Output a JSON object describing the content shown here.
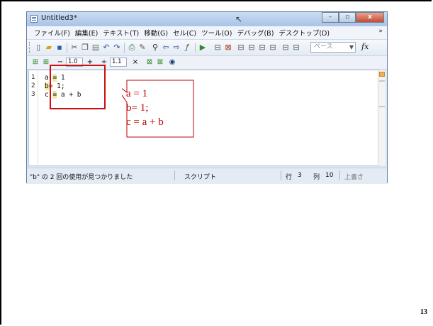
{
  "window": {
    "title": "Untitled3*",
    "minimize": "–",
    "maximize": "▫",
    "close": "x"
  },
  "menu": {
    "items": [
      "ファイル(F)",
      "編集(E)",
      "テキスト(T)",
      "移動(G)",
      "セル(C)",
      "ツール(O)",
      "デバッグ(B)",
      "デスクトップ(D)"
    ],
    "more": "»"
  },
  "toolbar": {
    "base_select": "ベース",
    "fx_label": "fx"
  },
  "cellbar": {
    "minus": "−",
    "value1": "1.0",
    "plus": "+",
    "divide": "÷",
    "value2": "1.1",
    "times": "×"
  },
  "editor": {
    "lines": [
      {
        "no": "1",
        "pre": "a ",
        "hl": "=",
        "post": " 1"
      },
      {
        "no": "2",
        "pre": "",
        "hl": "b",
        "post": "= 1;"
      },
      {
        "no": "3",
        "pre": "c ",
        "hl": "=",
        "post": " a + b"
      }
    ]
  },
  "status": {
    "message": "\"b\" の 2 回の使用が見つかりました",
    "mode": "スクリプト",
    "row_label": "行",
    "row": "3",
    "col_label": "列",
    "col": "10",
    "overwrite": "上書き"
  },
  "callout": {
    "text": "a = 1\nb= 1;\nc = a + b",
    "color": "#c00000"
  },
  "page_number": "13"
}
